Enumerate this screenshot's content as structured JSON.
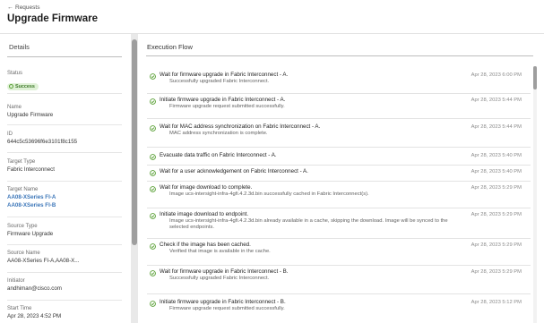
{
  "header": {
    "breadcrumb_label": "Requests",
    "title": "Upgrade Firmware"
  },
  "details": {
    "title": "Details",
    "status_label": "Status",
    "status_value": "Success",
    "name_label": "Name",
    "name_value": "Upgrade Firmware",
    "id_label": "ID",
    "id_value": "644c5c53696f6e3101f8c155",
    "target_type_label": "Target Type",
    "target_type_value": "Fabric Interconnect",
    "target_name_label": "Target Name",
    "target_names": [
      "AA08-XSeries FI-A",
      "AA08-XSeries FI-B"
    ],
    "source_type_label": "Source Type",
    "source_type_value": "Firmware Upgrade",
    "source_name_label": "Source Name",
    "source_name_value": "AA08-XSeries FI-A,AA08-X...",
    "initiator_label": "Initiator",
    "initiator_value": "andhiman@cisco.com",
    "start_time_label": "Start Time",
    "start_time_value": "Apr 28, 2023 4:52 PM"
  },
  "flow": {
    "title": "Execution Flow",
    "entries": [
      {
        "title": "Wait for firmware upgrade in Fabric Interconnect - A.",
        "detail": "Successfully upgraded Fabric Interconnect.",
        "time": "Apr 28, 2023 6:00 PM"
      },
      {
        "title": "Initiate firmware upgrade in Fabric Interconnect - A.",
        "detail": "Firmware upgrade request submitted successfully.",
        "time": "Apr 28, 2023 5:44 PM"
      },
      {
        "title": "Wait for MAC address synchronization on Fabric Interconnect - A.",
        "detail": "MAC address synchronization is complete.",
        "time": "Apr 28, 2023 5:44 PM"
      },
      {
        "title": "Evacuate data traffic on Fabric Interconnect - A.",
        "detail": "",
        "time": "Apr 28, 2023 5:40 PM"
      },
      {
        "title": "Wait for a user acknowledgement on Fabric Interconnect - A.",
        "detail": "",
        "time": "Apr 28, 2023 5:40 PM"
      },
      {
        "title": "Wait for image download to complete.",
        "detail": "Image ucs-intersight-infra-4gfi.4.2.3d.bin successfully cached in Fabric Interconnect(s).",
        "time": "Apr 28, 2023 5:29 PM"
      },
      {
        "title": "Initiate image download to endpoint.",
        "detail": "Image ucs-intersight-infra-4gfi.4.2.3d.bin already available in a cache, skipping the download. Image will be synced to the selected endpoints.",
        "time": "Apr 28, 2023 5:29 PM"
      },
      {
        "title": "Check if the image has been cached.",
        "detail": "Verified that image is available in the cache.",
        "time": "Apr 28, 2023 5:29 PM"
      },
      {
        "title": "Wait for firmware upgrade in Fabric Interconnect - B.",
        "detail": "Successfully upgraded Fabric Interconnect.",
        "time": "Apr 28, 2023 5:29 PM"
      },
      {
        "title": "Initiate firmware upgrade in Fabric Interconnect - B.",
        "detail": "Firmware upgrade request submitted successfully.",
        "time": "Apr 28, 2023 5:12 PM"
      }
    ]
  },
  "colors": {
    "success": "#5aa036",
    "link": "#3d77b9"
  },
  "icons": {
    "back": "arrow-left-icon",
    "entry": "check-circle-icon"
  }
}
